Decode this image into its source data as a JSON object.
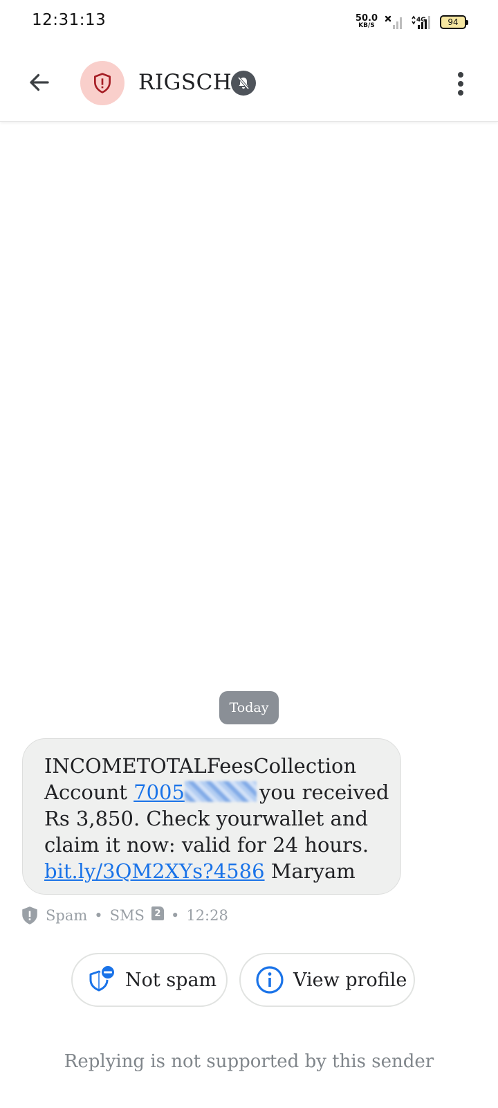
{
  "status_bar": {
    "time": "12:31:13",
    "net_speed_value": "50.0",
    "net_speed_unit": "KB/S",
    "network_type": "4G",
    "battery_level": "94"
  },
  "app_bar": {
    "sender_name": "RIGSCH",
    "avatar_icon": "shield-alert-icon",
    "avatar_color": "#f9cfcb",
    "muted_icon": "bell-off-icon",
    "menu_icon": "more-vert-icon",
    "back_icon": "arrow-back-icon"
  },
  "thread": {
    "date_label": "Today",
    "message": {
      "line1": "INCOMETOTALFeesCollection",
      "line2_prefix": "Account ",
      "account_link": "7005",
      "line2_suffix": "you received",
      "line3": "Rs 3,850. Check yourwallet and",
      "line4": "claim it now: valid for 24 hours.",
      "url_link": "bit.ly/3QM2XYs?4586",
      "line5_suffix": " Maryam"
    },
    "meta": {
      "label": "Spam",
      "channel": "SMS",
      "sim_slot": "2",
      "time": "12:28"
    }
  },
  "actions": {
    "not_spam_label": "Not spam",
    "view_profile_label": "View profile"
  },
  "footer": {
    "reply_note": "Replying is not supported by this sender"
  },
  "colors": {
    "accent": "#1a73e8",
    "spam_red": "#a51d24",
    "bubble_bg": "#eff0ef",
    "chip_gray": "#8a8f96"
  }
}
